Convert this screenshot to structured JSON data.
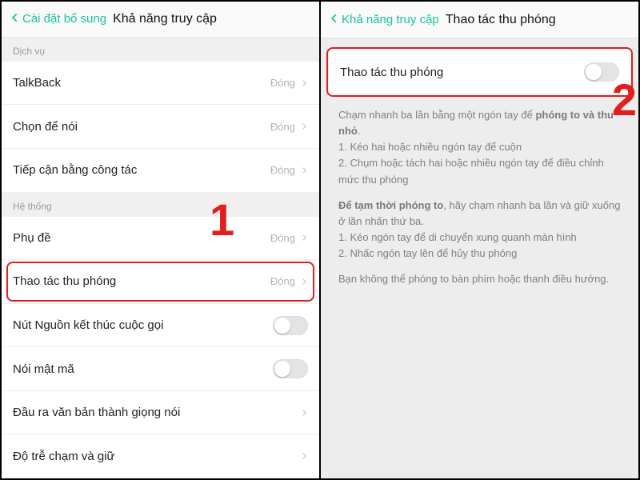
{
  "left": {
    "back_label": "Cài đặt bổ sung",
    "title": "Khả năng truy cập",
    "section_service": "Dịch vụ",
    "section_system": "Hệ thống",
    "status_closed": "Đóng",
    "items_service": [
      {
        "label": "TalkBack"
      },
      {
        "label": "Chọn để nói"
      },
      {
        "label": "Tiếp cận bằng công tác"
      }
    ],
    "items_system": [
      {
        "label": "Phụ đề",
        "kind": "nav"
      },
      {
        "label": "Thao tác thu phóng",
        "kind": "nav",
        "highlight": true
      },
      {
        "label": "Nút Nguồn kết thúc cuộc gọi",
        "kind": "toggle"
      },
      {
        "label": "Nói mật mã",
        "kind": "toggle"
      },
      {
        "label": "Đầu ra văn bản thành giọng nói",
        "kind": "nav"
      },
      {
        "label": "Độ trễ chạm và giữ",
        "kind": "nav"
      }
    ],
    "callout": "1"
  },
  "right": {
    "back_label": "Khả năng truy cập",
    "title": "Thao tác thu phóng",
    "zoom_label": "Thao tác thu phóng",
    "callout": "2",
    "guide": {
      "p1_pre": "Chạm nhanh ba lần bằng một ngón tay để ",
      "p1_bold": "phóng to và thu nhỏ",
      "p1_post": ".",
      "p1_l1": "1. Kéo hai hoặc nhiều ngón tay để cuộn",
      "p1_l2": "2. Chụm hoặc tách hai hoặc nhiều ngón tay để điều chỉnh mức thu phóng",
      "p2_bold": "Để tạm thời phóng to",
      "p2_post": ", hãy chạm nhanh ba lần và giữ xuống ở lần nhấn thứ ba.",
      "p2_l1": "1. Kéo ngón tay để di chuyển xung quanh màn hình",
      "p2_l2": "2. Nhấc ngón tay lên để hủy thu phóng",
      "p3": "Bạn không thể phóng to bàn phím hoặc thanh điều hướng."
    }
  }
}
